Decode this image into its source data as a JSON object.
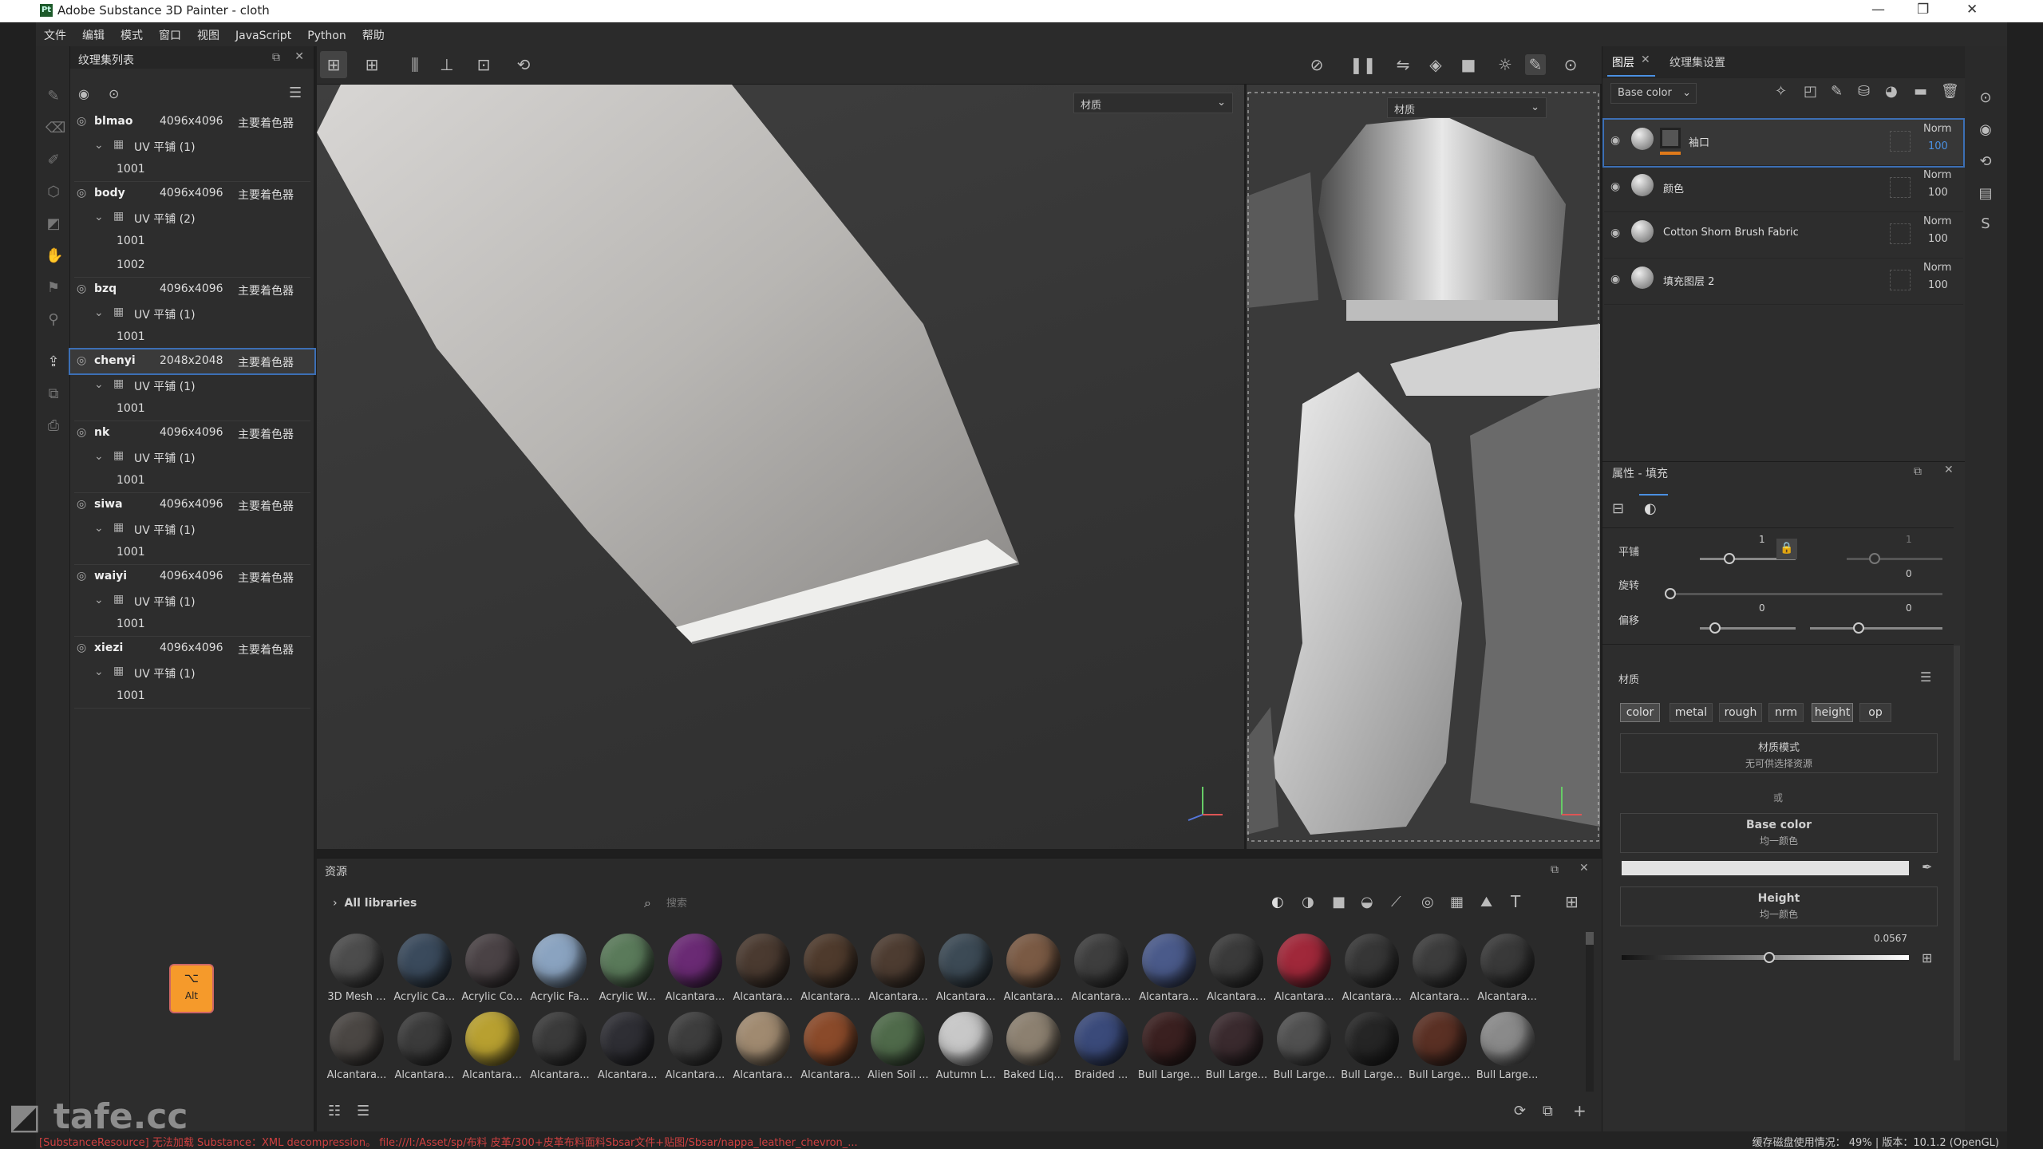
{
  "window": {
    "title": "Adobe Substance 3D Painter - cloth",
    "logo": "Pt"
  },
  "menu": [
    "文件",
    "编辑",
    "模式",
    "窗口",
    "视图",
    "JavaScript",
    "Python",
    "帮助"
  ],
  "texture_panel": {
    "title": "纹理集列表",
    "sets": [
      {
        "name": "blmao",
        "res": "4096x4096",
        "shader": "主要着色器",
        "uv": "UV 平铺 (1)",
        "tiles": [
          "1001"
        ]
      },
      {
        "name": "body",
        "res": "4096x4096",
        "shader": "主要着色器",
        "uv": "UV 平铺 (2)",
        "tiles": [
          "1001",
          "1002"
        ]
      },
      {
        "name": "bzq",
        "res": "4096x4096",
        "shader": "主要着色器",
        "uv": "UV 平铺 (1)",
        "tiles": [
          "1001"
        ]
      },
      {
        "name": "chenyi",
        "res": "2048x2048",
        "shader": "主要着色器",
        "uv": "UV 平铺 (1)",
        "tiles": [
          "1001"
        ],
        "selected": true
      },
      {
        "name": "nk",
        "res": "4096x4096",
        "shader": "主要着色器",
        "uv": "UV 平铺 (1)",
        "tiles": [
          "1001"
        ]
      },
      {
        "name": "siwa",
        "res": "4096x4096",
        "shader": "主要着色器",
        "uv": "UV 平铺 (1)",
        "tiles": [
          "1001"
        ]
      },
      {
        "name": "waiyi",
        "res": "4096x4096",
        "shader": "主要着色器",
        "uv": "UV 平铺 (1)",
        "tiles": [
          "1001"
        ]
      },
      {
        "name": "xiezi",
        "res": "4096x4096",
        "shader": "主要着色器",
        "uv": "UV 平铺 (1)",
        "tiles": [
          "1001"
        ]
      }
    ]
  },
  "viewport": {
    "view3d_mode": "材质",
    "view2d_mode": "材质",
    "axis": {
      "y": "Y"
    }
  },
  "alt_badge": {
    "symbol": "⌥",
    "label": "Alt"
  },
  "assets": {
    "title": "资源",
    "library": "All libraries",
    "search_placeholder": "搜索",
    "row1": [
      {
        "label": "3D Mesh ...",
        "color": "#4c4c4c"
      },
      {
        "label": "Acrylic Ca...",
        "color": "#3a4a5c"
      },
      {
        "label": "Acrylic Co...",
        "color": "#4a4245"
      },
      {
        "label": "Acrylic Fa...",
        "color": "#8aa3c0"
      },
      {
        "label": "Acrylic W...",
        "color": "#5a7a5a"
      },
      {
        "label": "Alcantara...",
        "color": "#6a2a74"
      },
      {
        "label": "Alcantara...",
        "color": "#4a3a30"
      },
      {
        "label": "Alcantara...",
        "color": "#4e3a2c"
      },
      {
        "label": "Alcantara...",
        "color": "#4d3c31"
      },
      {
        "label": "Alcantara...",
        "color": "#3c4a55"
      },
      {
        "label": "Alcantara...",
        "color": "#7a5a44"
      },
      {
        "label": "Alcantara...",
        "color": "#3e3e3e"
      },
      {
        "label": "Alcantara...",
        "color": "#4a5a8a"
      },
      {
        "label": "Alcantara...",
        "color": "#3a3a3a"
      },
      {
        "label": "Alcantara...",
        "color": "#a0283a"
      },
      {
        "label": "Alcantara...",
        "color": "#363636"
      },
      {
        "label": "Alcantara...",
        "color": "#3c3c3c"
      },
      {
        "label": "Alcantara...",
        "color": "#393939"
      }
    ],
    "row2": [
      {
        "label": "Alcantara...",
        "color": "#4a4643"
      },
      {
        "label": "Alcantara...",
        "color": "#3b3b3b"
      },
      {
        "label": "Alcantara...",
        "color": "#b8a030"
      },
      {
        "label": "Alcantara...",
        "color": "#3a3a3a"
      },
      {
        "label": "Alcantara...",
        "color": "#2e2e34"
      },
      {
        "label": "Alcantara...",
        "color": "#3d3d3d"
      },
      {
        "label": "Alcantara...",
        "color": "#a08a70"
      },
      {
        "label": "Alcantara...",
        "color": "#8a4a2a"
      },
      {
        "label": "Alien Soil ...",
        "color": "#4f6a4a"
      },
      {
        "label": "Autumn L...",
        "color": "#c8c8c8"
      },
      {
        "label": "Baked Liq...",
        "color": "#8c8070"
      },
      {
        "label": "Braided ...",
        "color": "#3a4a7a"
      },
      {
        "label": "Bull Large...",
        "color": "#3a2020"
      },
      {
        "label": "Bull Large...",
        "color": "#3a2a2e"
      },
      {
        "label": "Bull Large...",
        "color": "#505050"
      },
      {
        "label": "Bull Large...",
        "color": "#252525"
      },
      {
        "label": "Bull Large...",
        "color": "#5a3024"
      },
      {
        "label": "Bull Large...",
        "color": "#8a8a8a"
      }
    ]
  },
  "layers_panel": {
    "tab_layers": "图层",
    "tab_texset": "纹理集设置",
    "channel": "Base color",
    "layers": [
      {
        "name": "袖口",
        "blend": "Norm",
        "opacity": "100",
        "selected": true
      },
      {
        "name": "颜色",
        "blend": "Norm",
        "opacity": "100"
      },
      {
        "name": "Cotton Shorn Brush Fabric",
        "blend": "Norm",
        "opacity": "100"
      },
      {
        "name": "填充图层 2",
        "blend": "Norm",
        "opacity": "100"
      }
    ]
  },
  "properties": {
    "title": "属性 - 填充",
    "tiling_label": "平铺",
    "tiling_val": "1",
    "tiling_val2": "1",
    "rotation_label": "旋转",
    "rotation_val": "0",
    "offset_label": "偏移",
    "offset_val": "0",
    "offset_val2": "0",
    "material_label": "材质",
    "channels": [
      "color",
      "metal",
      "rough",
      "nrm",
      "height",
      "op"
    ],
    "material_mode_title": "材质模式",
    "material_mode_sub": "无可供选择资源",
    "or": "或",
    "base_color_title": "Base color",
    "base_color_sub": "均一颜色",
    "base_color_value": "#e2e2e2",
    "height_title": "Height",
    "height_sub": "均一颜色",
    "height_value": "0.0567"
  },
  "status": {
    "error": "[SubstanceResource] 无法加载 Substance：XML decompression。 file:///I:/Asset/sp/布料 皮革/300+皮革布料面料Sbsar文件+贴图/Sbsar/nappa_leather_chevron_...",
    "right": "缓存磁盘使用情况：   49% | 版本：10.1.2 (OpenGL)"
  },
  "watermark": "tafe.cc"
}
